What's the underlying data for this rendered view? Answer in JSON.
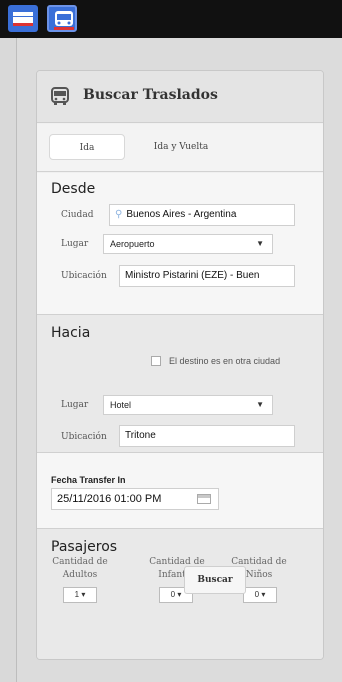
{
  "nav": {
    "tabs": [
      {
        "name": "hotel",
        "icon": "bed-icon"
      },
      {
        "name": "transfer",
        "icon": "bus-icon"
      }
    ]
  },
  "panel": {
    "title": "Buscar Traslados",
    "trip_tabs": [
      "Ida",
      "Ida y Vuelta"
    ],
    "desde": {
      "heading": "Desde",
      "ciudad_label": "Ciudad",
      "ciudad_value": "Buenos Aires - Argentina",
      "lugar_label": "Lugar",
      "lugar_value": "Aeropuerto",
      "ubicacion_label": "Ubicación",
      "ubicacion_value": "Ministro Pistarini (EZE) - Buen"
    },
    "hacia": {
      "heading": "Hacia",
      "otra_ciudad_label": "El destino es en otra ciudad",
      "lugar_label": "Lugar",
      "lugar_value": "Hotel",
      "ubicacion_label": "Ubicación",
      "ubicacion_value": "Tritone"
    },
    "fecha": {
      "label": "Fecha Transfer In",
      "value": "25/11/2016 01:00 PM"
    },
    "pasajeros": {
      "heading": "Pasajeros",
      "adultos_label_1": "Cantidad de",
      "adultos_label_2": "Adultos",
      "adultos_value": "1 ▾",
      "infantes_label_1": "Cantidad de",
      "infantes_label_2": "Infantes",
      "infantes_value": "0 ▾",
      "ninos_label_1": "Cantidad de",
      "ninos_label_2": "Niños",
      "ninos_value": "0 ▾"
    },
    "search_button": "Buscar"
  }
}
